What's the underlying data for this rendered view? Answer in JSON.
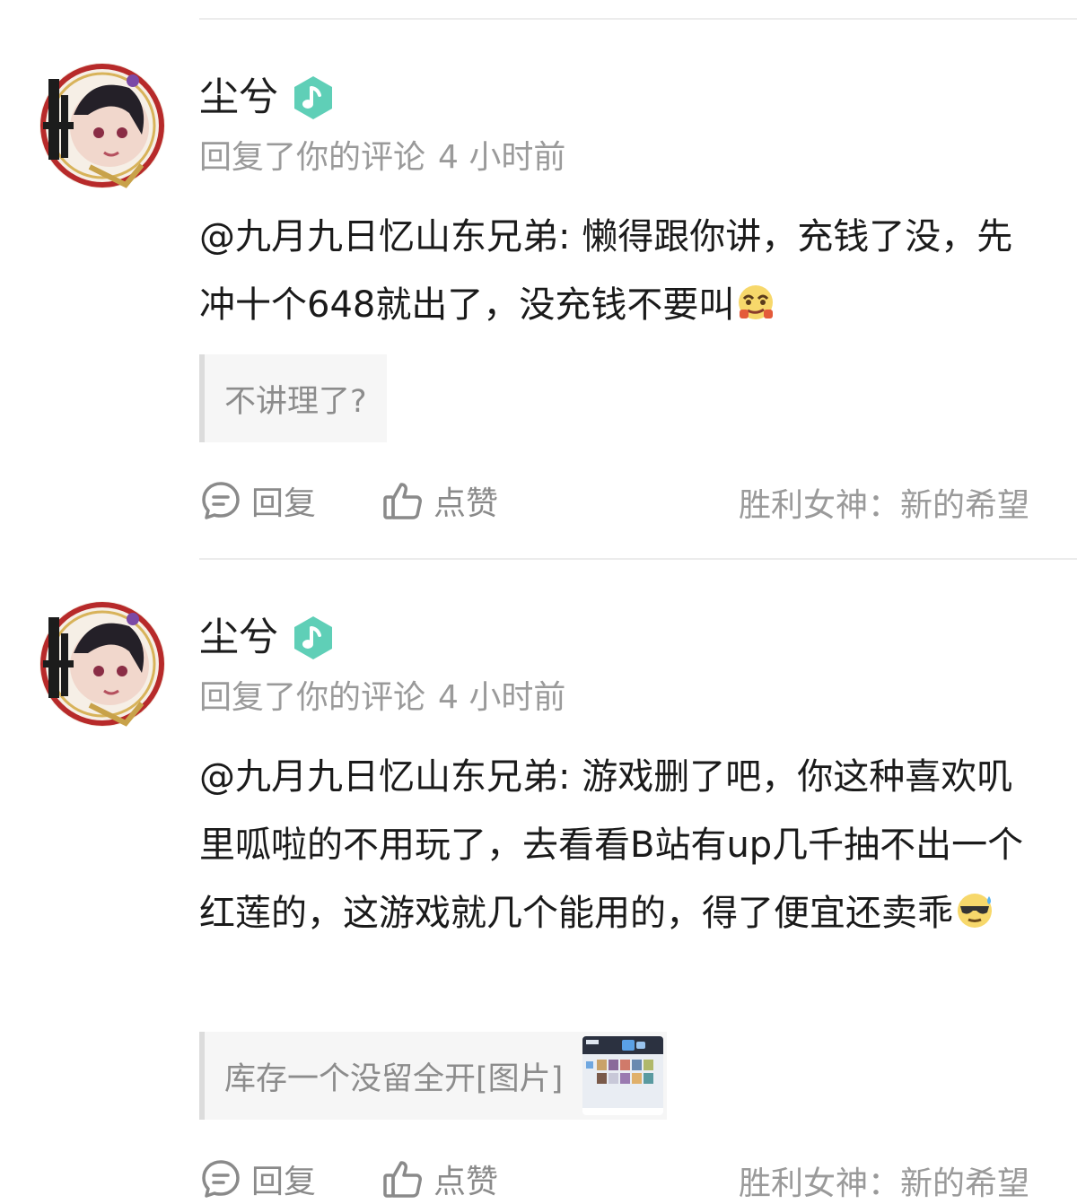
{
  "comments": [
    {
      "user": "尘兮",
      "badge_icon": "music-note-icon",
      "action_text": "回复了你的评论",
      "time": "4 小时前",
      "content": "@九月九日忆山东兄弟: 懒得跟你讲，充钱了没，先冲十个648就出了，没充钱不要叫",
      "content_emoji": "smug-face-emoji",
      "quoted_text": "不讲理了?",
      "reply_label": "回复",
      "like_label": "点赞",
      "source": "胜利女神：新的希望"
    },
    {
      "user": "尘兮",
      "badge_icon": "music-note-icon",
      "action_text": "回复了你的评论",
      "time": "4 小时前",
      "content": "@九月九日忆山东兄弟: 游戏删了吧，你这种喜欢叽里呱啦的不用玩了，去看看B站有up几千抽不出一个红莲的，这游戏就几个能用的，得了便宜还卖乖",
      "content_emoji": "sweat-sunglasses-emoji",
      "quoted_text": "库存一个没留全开[图片]",
      "reply_label": "回复",
      "like_label": "点赞",
      "source": "胜利女神：新的希望"
    }
  ],
  "colors": {
    "badge": "#5fcfb7",
    "text": "#1a1a1a",
    "secondary": "#9a9a9a",
    "divider": "#ececec"
  }
}
